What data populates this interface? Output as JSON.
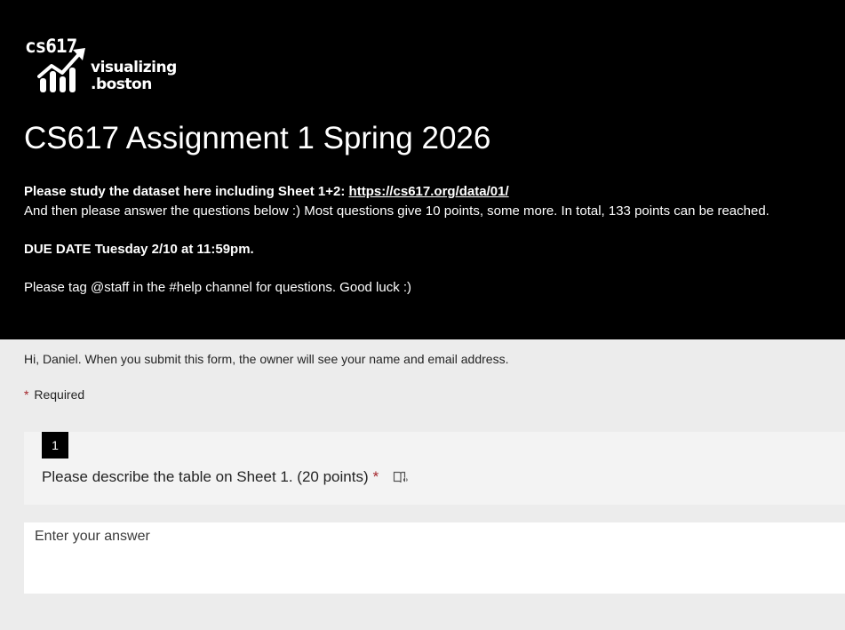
{
  "header": {
    "logo": {
      "prefix": "cs617",
      "word1": "visualizing",
      "word2": ".boston"
    },
    "title": "CS617 Assignment 1 Spring 2026",
    "description": {
      "line1_bold": "Please study the dataset here including Sheet 1+2: ",
      "line1_link": "https://cs617.org/data/01/",
      "line2": "And then please answer the questions below :) Most questions give 10 points, some more. In total, 133 points can be reached.",
      "due": "DUE DATE Tuesday 2/10 at 11:59pm.",
      "help": "Please tag @staff in the #help channel for questions. Good luck :)"
    }
  },
  "form": {
    "info": "Hi, Daniel. When you submit this form, the owner will see your name and email address.",
    "required_star": "*",
    "required_label": "Required",
    "questions": [
      {
        "number": "1",
        "text": "Please describe the table on Sheet 1. (20 points)",
        "required_star": "*",
        "icon": "immersive-reader-icon",
        "answer_placeholder": "Enter your answer"
      }
    ]
  }
}
